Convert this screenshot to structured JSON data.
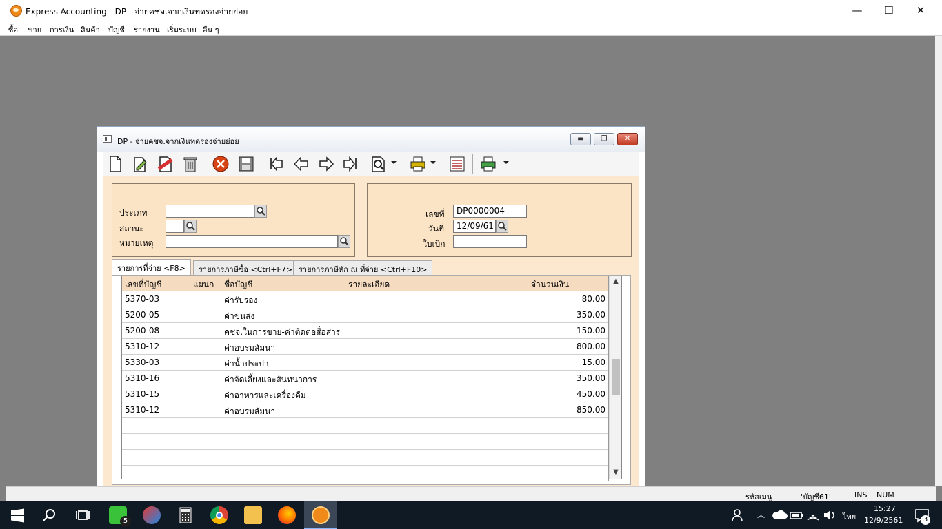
{
  "app": {
    "title": "Express Accounting - DP - จ่ายคชจ.จากเงินทดรองจ่ายย่อย",
    "window_controls": {
      "minimize": "—",
      "maximize": "☐",
      "close": "✕"
    }
  },
  "menu": [
    "ซื้อ",
    "ขาย",
    "การเงิน",
    "สินค้า",
    "บัญชี",
    "รายงาน",
    "เริ่มระบบ",
    "อื่น ๆ"
  ],
  "child_window": {
    "title": "DP - จ่ายคชจ.จากเงินทดรองจ่ายย่อย",
    "toolbar_icons": [
      "new-document-icon",
      "edit-icon",
      "void-icon",
      "delete-icon",
      "cancel-icon",
      "save-icon",
      "first-record-icon",
      "previous-record-icon",
      "next-record-icon",
      "last-record-icon",
      "search-icon",
      "print-icon",
      "form-icon",
      "print-preview-icon"
    ]
  },
  "header_left": {
    "type_label": "ประเภท",
    "type_value": "",
    "status_label": "สถานะ",
    "status_value": "",
    "note_label": "หมายเหตุ",
    "note_value": ""
  },
  "header_right": {
    "number_label": "เลขที่",
    "number_value": "DP0000004",
    "date_label": "วันที่",
    "date_value": "12/09/61",
    "voucher_label": "ใบเบิก",
    "voucher_value": ""
  },
  "tabs": [
    {
      "label": "รายการที่จ่าย <F8>",
      "active": true
    },
    {
      "label": "รายการภาษีซื้อ <Ctrl+F7>",
      "active": false
    },
    {
      "label": "รายการภาษีหัก ณ ที่จ่าย <Ctrl+F10>",
      "active": false
    }
  ],
  "grid": {
    "columns": [
      "เลขที่บัญชี",
      "แผนก",
      "ชื่อบัญชี",
      "รายละเอียด",
      "จำนวนเงิน"
    ],
    "rows": [
      {
        "account": "5370-03",
        "dept": "",
        "name": "ค่ารับรอง",
        "detail": "",
        "amount": "80.00"
      },
      {
        "account": "5200-05",
        "dept": "",
        "name": "ค่าขนส่ง",
        "detail": "",
        "amount": "350.00"
      },
      {
        "account": "5200-08",
        "dept": "",
        "name": "คชจ.ในการขาย-ค่าติดต่อสื่อสาร",
        "detail": "",
        "amount": "150.00"
      },
      {
        "account": "5310-12",
        "dept": "",
        "name": "ค่าอบรมสัมนา",
        "detail": "",
        "amount": "800.00"
      },
      {
        "account": "5330-03",
        "dept": "",
        "name": "ค่าน้ำประปา",
        "detail": "",
        "amount": "15.00"
      },
      {
        "account": "5310-16",
        "dept": "",
        "name": "ค่าจัดเลี้ยงและสันทนาการ",
        "detail": "",
        "amount": "350.00"
      },
      {
        "account": "5310-15",
        "dept": "",
        "name": "ค่าอาหารและเครื่องดื่ม",
        "detail": "",
        "amount": "450.00"
      },
      {
        "account": "5310-12",
        "dept": "",
        "name": "ค่าอบรมสัมนา",
        "detail": "",
        "amount": "850.00"
      },
      {
        "account": "",
        "dept": "",
        "name": "",
        "detail": "",
        "amount": ""
      },
      {
        "account": "",
        "dept": "",
        "name": "",
        "detail": "",
        "amount": ""
      },
      {
        "account": "",
        "dept": "",
        "name": "",
        "detail": "",
        "amount": ""
      },
      {
        "account": "",
        "dept": "",
        "name": "",
        "detail": "",
        "amount": ""
      }
    ]
  },
  "status_bar": {
    "menu_code": "รหัสเมนู",
    "database": "'บัญชี61'",
    "ins": "INS",
    "num": "NUM"
  },
  "taskbar": {
    "apps": [
      "windows-start-icon",
      "search-icon",
      "task-view-icon",
      "line-app-icon",
      "snipping-tool-icon",
      "calculator-icon",
      "chrome-icon",
      "file-explorer-icon",
      "firefox-icon",
      "express-accounting-icon"
    ],
    "line_badge": "5",
    "language": "ไทย",
    "time": "15:27",
    "date": "12/9/2561",
    "notification_count": "3"
  },
  "colors": {
    "panel_bg": "#fbe8cf",
    "grid_header": "#f5dcc0",
    "taskbar": "#101a25",
    "close_red": "#c23a22"
  }
}
